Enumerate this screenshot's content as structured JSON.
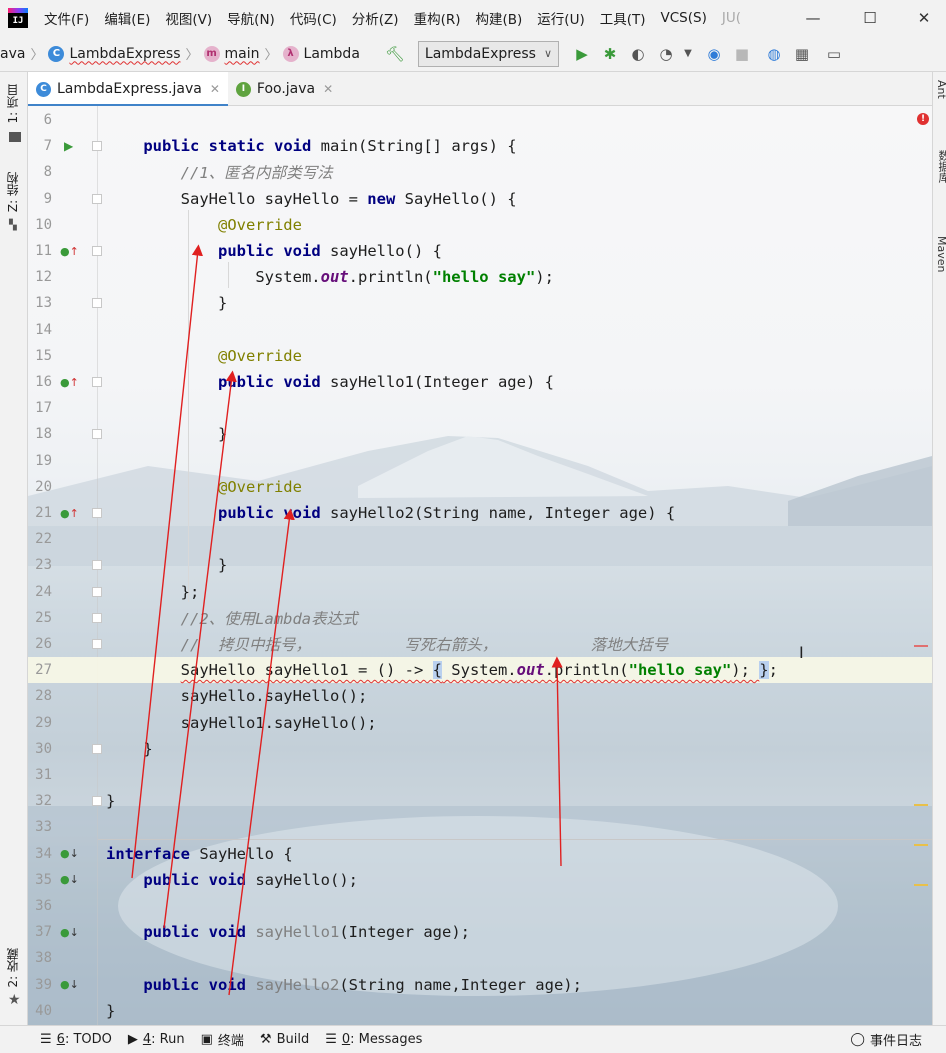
{
  "menu": {
    "items": [
      "文件(F)",
      "编辑(E)",
      "视图(V)",
      "导航(N)",
      "代码(C)",
      "分析(Z)",
      "重构(R)",
      "构建(B)",
      "运行(U)",
      "工具(T)",
      "VCS(S)",
      "JU("
    ]
  },
  "navbar": {
    "crumbs": [
      {
        "label": "ava",
        "icon": ""
      },
      {
        "label": "LambdaExpress",
        "icon": "class-icon"
      },
      {
        "label": "main",
        "icon": "method-icon"
      },
      {
        "label": "Lambda",
        "icon": "lambda-icon"
      }
    ],
    "run_config": "LambdaExpress"
  },
  "left_stripe": {
    "project": "1: 项目",
    "structure": "Z: 结构",
    "favorites": "2: 收藏"
  },
  "right_stripe": {
    "ant": "Ant",
    "database": "数据库",
    "maven": "Maven"
  },
  "tabs": [
    {
      "label": "LambdaExpress.java",
      "icon": "C",
      "active": true
    },
    {
      "label": "Foo.java",
      "icon": "I",
      "active": false
    }
  ],
  "code": {
    "lines": [
      {
        "n": "6",
        "gutter": "",
        "html_key": "l6"
      },
      {
        "n": "7",
        "gutter": "run",
        "html_key": "l7"
      },
      {
        "n": "8",
        "gutter": "",
        "html_key": "l8"
      },
      {
        "n": "9",
        "gutter": "",
        "html_key": "l9"
      },
      {
        "n": "10",
        "gutter": "",
        "html_key": "l10"
      },
      {
        "n": "11",
        "gutter": "impl-up",
        "html_key": "l11"
      },
      {
        "n": "12",
        "gutter": "",
        "html_key": "l12"
      },
      {
        "n": "13",
        "gutter": "",
        "html_key": "l13"
      },
      {
        "n": "14",
        "gutter": "",
        "html_key": "l14"
      },
      {
        "n": "15",
        "gutter": "",
        "html_key": "l15"
      },
      {
        "n": "16",
        "gutter": "impl-up",
        "html_key": "l16"
      },
      {
        "n": "17",
        "gutter": "",
        "html_key": "l17"
      },
      {
        "n": "18",
        "gutter": "",
        "html_key": "l18"
      },
      {
        "n": "19",
        "gutter": "",
        "html_key": "l19"
      },
      {
        "n": "20",
        "gutter": "",
        "html_key": "l20"
      },
      {
        "n": "21",
        "gutter": "impl-up",
        "html_key": "l21"
      },
      {
        "n": "22",
        "gutter": "",
        "html_key": "l22"
      },
      {
        "n": "23",
        "gutter": "",
        "html_key": "l23"
      },
      {
        "n": "24",
        "gutter": "",
        "html_key": "l24"
      },
      {
        "n": "25",
        "gutter": "",
        "html_key": "l25"
      },
      {
        "n": "26",
        "gutter": "",
        "html_key": "l26"
      },
      {
        "n": "27",
        "gutter": "",
        "html_key": "l27"
      },
      {
        "n": "28",
        "gutter": "",
        "html_key": "l28"
      },
      {
        "n": "29",
        "gutter": "",
        "html_key": "l29"
      },
      {
        "n": "30",
        "gutter": "",
        "html_key": "l30"
      },
      {
        "n": "31",
        "gutter": "",
        "html_key": "l31"
      },
      {
        "n": "32",
        "gutter": "",
        "html_key": "l32"
      },
      {
        "n": "33",
        "gutter": "",
        "html_key": "l33"
      },
      {
        "n": "34",
        "gutter": "impl-down",
        "html_key": "l34"
      },
      {
        "n": "35",
        "gutter": "impl-down",
        "html_key": "l35"
      },
      {
        "n": "36",
        "gutter": "",
        "html_key": "l36"
      },
      {
        "n": "37",
        "gutter": "impl-down",
        "html_key": "l37"
      },
      {
        "n": "38",
        "gutter": "",
        "html_key": "l38"
      },
      {
        "n": "39",
        "gutter": "impl-down",
        "html_key": "l39"
      },
      {
        "n": "40",
        "gutter": "",
        "html_key": "l40"
      }
    ],
    "tokens": {
      "public": "public",
      "static": "static",
      "void": "void",
      "new": "new",
      "interface": "interface",
      "override": "@Override",
      "main_sig": " main(String[] args) {",
      "cmt_anon": "//1、匿名内部类写法",
      "sayhello_decl_a": "SayHello sayHello = ",
      "sayhello_decl_b": " SayHello() {",
      "sayhello_method": " sayHello() {",
      "sysout_a": "System.",
      "out": "out",
      "sysout_b": ".println(",
      "hello_say": "\"hello say\"",
      "sysout_c": ");",
      "close_brace": "}",
      "sayhello1_method": " sayHello1(Integer age) {",
      "sayhello2_method": " sayHello2(String name, Integer age) {",
      "close_brace_semi": "};",
      "cmt_lambda": "//2、使用Lambda表达式",
      "cmt_copy": "//  拷贝中括号，          写死右箭头，          落地大括号",
      "lambda_a": "SayHello sayHello1 = () -> ",
      "lambda_open": "{",
      "lambda_b": " System.",
      "lambda_c": ".println(",
      "lambda_d": "); ",
      "lambda_close": "}",
      "lambda_semi": ";",
      "call1": "sayHello.sayHello();",
      "call2": "sayHello1.sayHello();",
      "iface_name": " SayHello {",
      "iface_m1_name": "sayHello();",
      "iface_m2_name": "sayHello1",
      "iface_m2_args": "(Integer age);",
      "iface_m3_name": "sayHello2",
      "iface_m3_args": "(String name,Integer age);"
    }
  },
  "statusbar": {
    "todo_num": "6",
    "todo_label": ": TODO",
    "run_num": "4",
    "run_label": ": Run",
    "terminal": "终端",
    "build": "Build",
    "messages_num": "0",
    "messages_label": ": Messages",
    "event_log": "事件日志"
  },
  "colors": {
    "keyword": "#000080",
    "annotation": "#808000",
    "string": "#008000",
    "comment": "#808080",
    "arrow": "#e02020",
    "tab_active_underline": "#4083c9"
  }
}
